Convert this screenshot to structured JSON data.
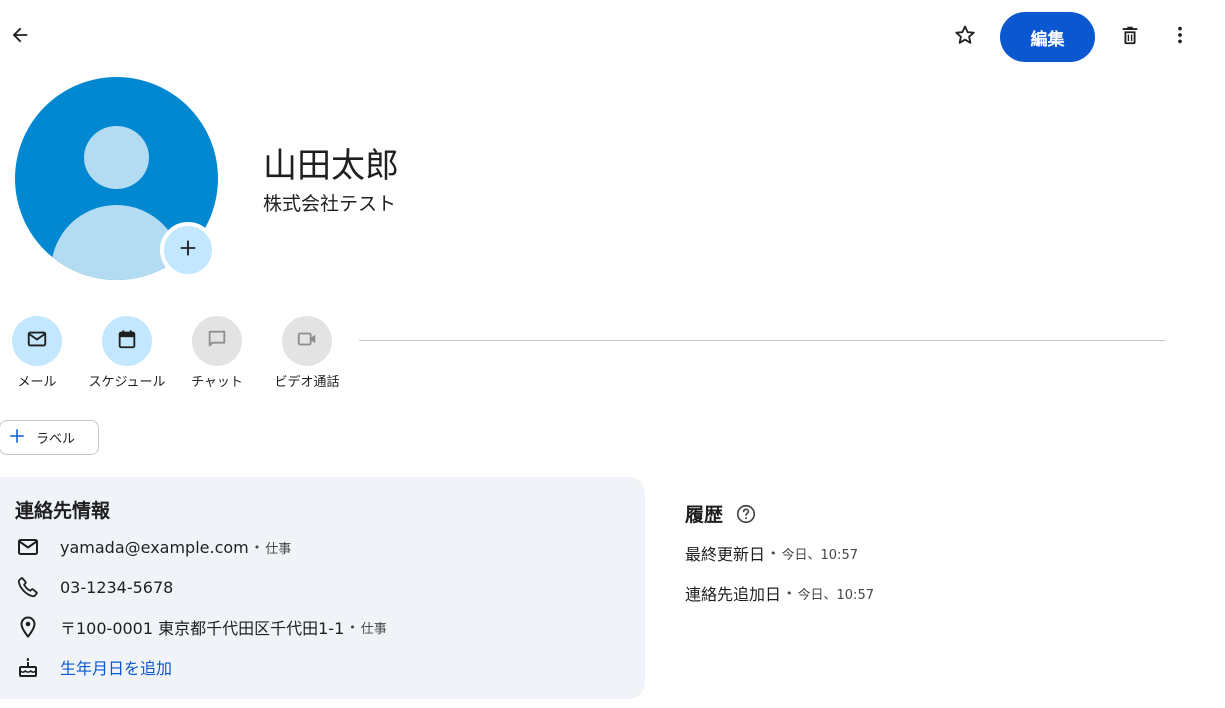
{
  "toolbar": {
    "back_icon": "arrow-back-icon",
    "star_icon": "star-outline-icon",
    "edit_label": "編集",
    "delete_icon": "trash-icon",
    "more_icon": "more-vert-icon"
  },
  "contact": {
    "name": "山田太郎",
    "company": "株式会社テスト",
    "avatar_color": "#0288d1",
    "add_photo_icon": "plus-icon"
  },
  "actions": [
    {
      "label": "メール",
      "icon": "mail-icon",
      "enabled": true
    },
    {
      "label": "スケジュール",
      "icon": "calendar-icon",
      "enabled": true
    },
    {
      "label": "チャット",
      "icon": "chat-icon",
      "enabled": false
    },
    {
      "label": "ビデオ通話",
      "icon": "video-icon",
      "enabled": false
    }
  ],
  "label_chip": {
    "label": "ラベル",
    "icon": "plus-icon"
  },
  "contact_info": {
    "title": "連絡先情報",
    "email": {
      "value": "yamada@example.com",
      "tag": "仕事",
      "icon": "mail-icon"
    },
    "phone": {
      "value": "03-1234-5678",
      "icon": "phone-icon"
    },
    "address": {
      "value": "〒100-0001 東京都千代田区千代田1-1",
      "tag": "仕事",
      "icon": "location-pin-icon"
    },
    "birthday": {
      "value": "生年月日を追加",
      "icon": "cake-icon"
    }
  },
  "history": {
    "title": "履歴",
    "help_icon": "help-circle-icon",
    "updated": {
      "label": "最終更新日",
      "value": "今日、10:57"
    },
    "added": {
      "label": "連絡先追加日",
      "value": "今日、10:57"
    }
  },
  "colors": {
    "accent": "#0b57d0",
    "chip_active": "#c2e7ff",
    "chip_disabled": "#e3e3e3",
    "card_bg": "#f0f4f9"
  }
}
